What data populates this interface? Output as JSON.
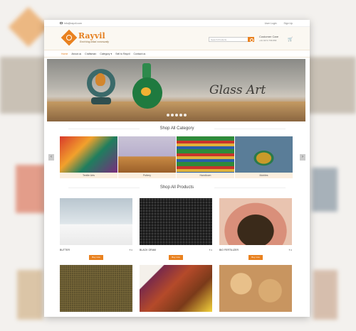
{
  "topbar": {
    "email": "info@rayvil.com",
    "login": "User Login",
    "signup": "Sign Up"
  },
  "brand": {
    "name": "Rayvil",
    "tagline": "Enriching tribal community"
  },
  "search": {
    "placeholder": "Search Products"
  },
  "care": {
    "title": "Customer Care",
    "phone": "+91 9474 758 858"
  },
  "cart": {
    "count": "0"
  },
  "nav": [
    "Home",
    "About us",
    "Craftsman",
    "Category ▾",
    "Sell to Rayvil",
    "Contact us"
  ],
  "hero": {
    "title": "Glass Art"
  },
  "sections": {
    "categories": "Shop All Category",
    "products": "Shop All Products"
  },
  "categories": [
    "Textile Arts",
    "Pottery",
    "Handloom",
    "Mobiles"
  ],
  "products": [
    {
      "name": "BUTTER",
      "price": "₹ 0",
      "button": "Buy now"
    },
    {
      "name": "BLACK GRAM",
      "price": "₹ 0",
      "button": "Buy now"
    },
    {
      "name": "BIO FERTILIZER",
      "price": "₹ 0",
      "button": "Buy now"
    }
  ]
}
